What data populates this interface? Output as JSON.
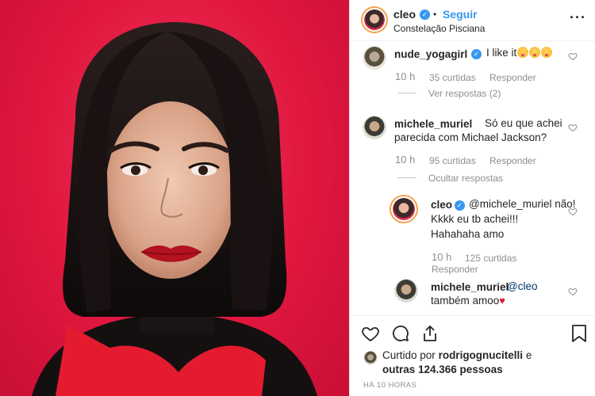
{
  "post": {
    "username": "cleo",
    "follow_label": "Seguir",
    "separator": "•",
    "location": "Constelação Pisciana",
    "more_label": "···"
  },
  "comments": [
    {
      "username": "nude_yogagirl",
      "verified": true,
      "text": "I like it",
      "emoji_count": 3,
      "time": "10 h",
      "likes": "35 curtidas",
      "reply_label": "Responder",
      "replies_toggle": "Ver respostas (2)"
    },
    {
      "username": "michele_muriel",
      "verified": false,
      "text_line1": "Só eu que achei",
      "text_line2": "parecida com Michael Jackson?",
      "time": "10 h",
      "likes": "95 curtidas",
      "reply_label": "Responder",
      "replies_toggle": "Ocultar respostas"
    }
  ],
  "replies": [
    {
      "username": "cleo",
      "verified": true,
      "text_line1": "@michele_muriel não!",
      "text_line2": "Kkkk eu tb achei!!!",
      "text_line3": "Hahahaha amo",
      "time": "10 h",
      "likes": "125 curtidas",
      "reply_label": "Responder"
    },
    {
      "username": "michele_muriel",
      "verified": false,
      "text_line1": "@cleo",
      "text_line2": "também amoo"
    }
  ],
  "likes_summary": {
    "prefix": "Curtido por",
    "user": "rodrigognucitelli",
    "conj": "e",
    "others": "outras 124.366 pessoas"
  },
  "timestamp": "HÁ 10 HORAS",
  "colors": {
    "link_blue": "#3897f0",
    "photo_background": "#e0173f",
    "meta_gray": "#8e8e8e"
  },
  "icons": [
    "heart-icon",
    "comment-icon",
    "share-icon",
    "bookmark-icon",
    "verified-icon",
    "more-options-icon"
  ]
}
